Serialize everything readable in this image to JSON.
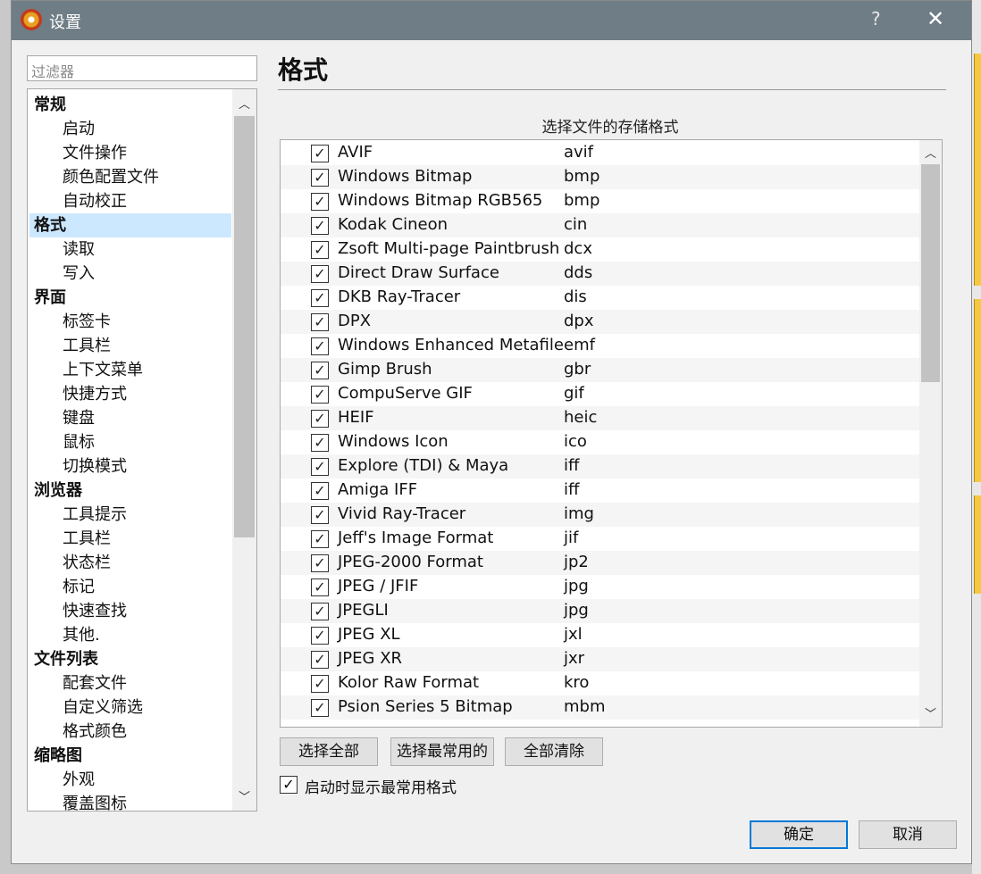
{
  "window": {
    "title": "设置",
    "help_label": "?",
    "close_label": "✕"
  },
  "sidebar": {
    "filter_placeholder": "过滤器",
    "items": [
      {
        "label": "常规",
        "level": 0
      },
      {
        "label": "启动",
        "level": 1
      },
      {
        "label": "文件操作",
        "level": 1
      },
      {
        "label": "颜色配置文件",
        "level": 1
      },
      {
        "label": "自动校正",
        "level": 1
      },
      {
        "label": "格式",
        "level": 0,
        "selected": true
      },
      {
        "label": "读取",
        "level": 1
      },
      {
        "label": "写入",
        "level": 1
      },
      {
        "label": "界面",
        "level": 0
      },
      {
        "label": "标签卡",
        "level": 1
      },
      {
        "label": "工具栏",
        "level": 1
      },
      {
        "label": "上下文菜单",
        "level": 1
      },
      {
        "label": "快捷方式",
        "level": 1
      },
      {
        "label": "键盘",
        "level": 1
      },
      {
        "label": "鼠标",
        "level": 1
      },
      {
        "label": "切换模式",
        "level": 1
      },
      {
        "label": "浏览器",
        "level": 0
      },
      {
        "label": "工具提示",
        "level": 1
      },
      {
        "label": "工具栏",
        "level": 1
      },
      {
        "label": "状态栏",
        "level": 1
      },
      {
        "label": "标记",
        "level": 1
      },
      {
        "label": "快速查找",
        "level": 1
      },
      {
        "label": "其他.",
        "level": 1
      },
      {
        "label": "文件列表",
        "level": 0
      },
      {
        "label": "配套文件",
        "level": 1
      },
      {
        "label": "自定义筛选",
        "level": 1
      },
      {
        "label": "格式颜色",
        "level": 1
      },
      {
        "label": "缩略图",
        "level": 0
      },
      {
        "label": "外观",
        "level": 1
      },
      {
        "label": "覆盖图标",
        "level": 1
      }
    ]
  },
  "main": {
    "page_title": "格式",
    "section_label": "选择文件的存储格式",
    "formats": [
      {
        "name": "AVIF",
        "ext": "avif",
        "checked": true
      },
      {
        "name": "Windows Bitmap",
        "ext": "bmp",
        "checked": true
      },
      {
        "name": "Windows Bitmap RGB565",
        "ext": "bmp",
        "checked": true
      },
      {
        "name": "Kodak Cineon",
        "ext": "cin",
        "checked": true
      },
      {
        "name": "Zsoft Multi-page Paintbrush",
        "ext": "dcx",
        "checked": true
      },
      {
        "name": "Direct Draw Surface",
        "ext": "dds",
        "checked": true
      },
      {
        "name": "DKB Ray-Tracer",
        "ext": "dis",
        "checked": true
      },
      {
        "name": "DPX",
        "ext": "dpx",
        "checked": true
      },
      {
        "name": "Windows Enhanced Metafile",
        "ext": "emf",
        "checked": true
      },
      {
        "name": "Gimp Brush",
        "ext": "gbr",
        "checked": true
      },
      {
        "name": "CompuServe GIF",
        "ext": "gif",
        "checked": true
      },
      {
        "name": "HEIF",
        "ext": "heic",
        "checked": true
      },
      {
        "name": "Windows Icon",
        "ext": "ico",
        "checked": true
      },
      {
        "name": "Explore (TDI) & Maya",
        "ext": "iff",
        "checked": true
      },
      {
        "name": "Amiga IFF",
        "ext": "iff",
        "checked": true
      },
      {
        "name": "Vivid Ray-Tracer",
        "ext": "img",
        "checked": true
      },
      {
        "name": "Jeff's Image Format",
        "ext": "jif",
        "checked": true
      },
      {
        "name": "JPEG-2000 Format",
        "ext": "jp2",
        "checked": true
      },
      {
        "name": "JPEG / JFIF",
        "ext": "jpg",
        "checked": true
      },
      {
        "name": "JPEGLI",
        "ext": "jpg",
        "checked": true
      },
      {
        "name": "JPEG XL",
        "ext": "jxl",
        "checked": true
      },
      {
        "name": "JPEG XR",
        "ext": "jxr",
        "checked": true
      },
      {
        "name": "Kolor Raw Format",
        "ext": "kro",
        "checked": true
      },
      {
        "name": "Psion Series 5 Bitmap",
        "ext": "mbm",
        "checked": true
      }
    ],
    "select_all_label": "选择全部",
    "select_common_label": "选择最常用的",
    "clear_all_label": "全部清除",
    "startup_checkbox_label": "启动时显示最常用格式",
    "startup_checked": true
  },
  "footer": {
    "ok_label": "确定",
    "cancel_label": "取消"
  },
  "colors": {
    "titlebar": "#6f7d86",
    "selection": "#cce8ff",
    "primary_border": "#0078d7"
  }
}
